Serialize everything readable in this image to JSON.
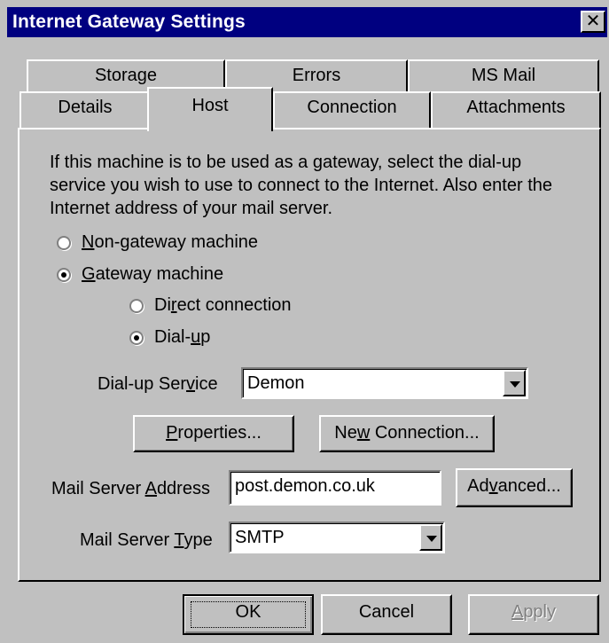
{
  "window": {
    "title": "Internet Gateway Settings",
    "close_glyph": "✕"
  },
  "tabs": {
    "row1": [
      "Storage",
      "Errors",
      "MS Mail"
    ],
    "row2": [
      "Details",
      "Host",
      "Connection",
      "Attachments"
    ],
    "active": "Host"
  },
  "host": {
    "intro": "If this machine is to be used as a gateway, select the dial-up service you wish to use to connect to the Internet. Also enter the Internet address of your mail server.",
    "radios": {
      "non_gateway": {
        "mn": "N",
        "rest": "on-gateway machine",
        "checked": false
      },
      "gateway": {
        "mn": "G",
        "rest": "ateway machine",
        "checked": true
      },
      "direct": {
        "pre": "Di",
        "mn": "r",
        "rest": "ect connection",
        "checked": false
      },
      "dialup": {
        "pre": "Dial-",
        "mn": "u",
        "rest": "p",
        "checked": true
      }
    },
    "dialup_service": {
      "pre": "Dial-up Ser",
      "mn": "v",
      "rest": "ice",
      "value": "Demon"
    },
    "properties_button": {
      "mn": "P",
      "rest": "roperties..."
    },
    "new_connection_button": {
      "pre": "Ne",
      "mn": "w",
      "rest": " Connection..."
    },
    "mail_server_address": {
      "pre": "Mail Server ",
      "mn": "A",
      "rest": "ddress",
      "value": "post.demon.co.uk"
    },
    "advanced_button": {
      "pre": "Ad",
      "mn": "v",
      "rest": "anced..."
    },
    "mail_server_type": {
      "pre": "Mail Server ",
      "mn": "T",
      "rest": "ype",
      "value": "SMTP"
    }
  },
  "footer": {
    "ok": {
      "pre": "",
      "mn": "",
      "rest": "OK"
    },
    "cancel": "Cancel",
    "apply": {
      "mn": "A",
      "rest": "pply",
      "enabled": false
    }
  }
}
